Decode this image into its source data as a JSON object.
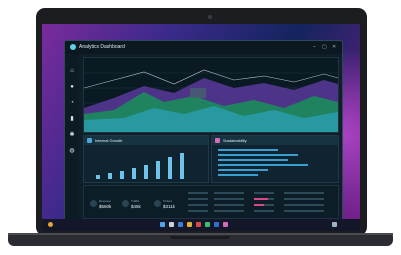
{
  "window": {
    "title": "Analytics Dashboard",
    "controls": {
      "minimize": "–",
      "maximize": "▢",
      "close": "✕"
    }
  },
  "sidebar": {
    "items": [
      {
        "icon": "home-icon",
        "glyph": "⌂"
      },
      {
        "icon": "user-icon",
        "glyph": "●"
      },
      {
        "icon": "pie-chart-icon",
        "glyph": "◔"
      },
      {
        "icon": "bar-chart-icon",
        "glyph": "▮"
      },
      {
        "icon": "gear-icon",
        "glyph": "✱"
      },
      {
        "icon": "globe-icon",
        "glyph": "◍"
      }
    ]
  },
  "cards": {
    "left": {
      "title": "Internal Growth",
      "accent": "#4aa8d8"
    },
    "right": {
      "title": "Sustainability",
      "accent": "#d86ab8"
    }
  },
  "kpis": [
    {
      "label": "Revenue",
      "value": "$560k"
    },
    {
      "label": "Traffic",
      "value": "$45k"
    },
    {
      "label": "Orders",
      "value": "$311k"
    }
  ],
  "colors": {
    "teal": "#2fb6b0",
    "green": "#1fa36a",
    "purple": "#6b3fa8",
    "blue": "#3a7fd0"
  }
}
